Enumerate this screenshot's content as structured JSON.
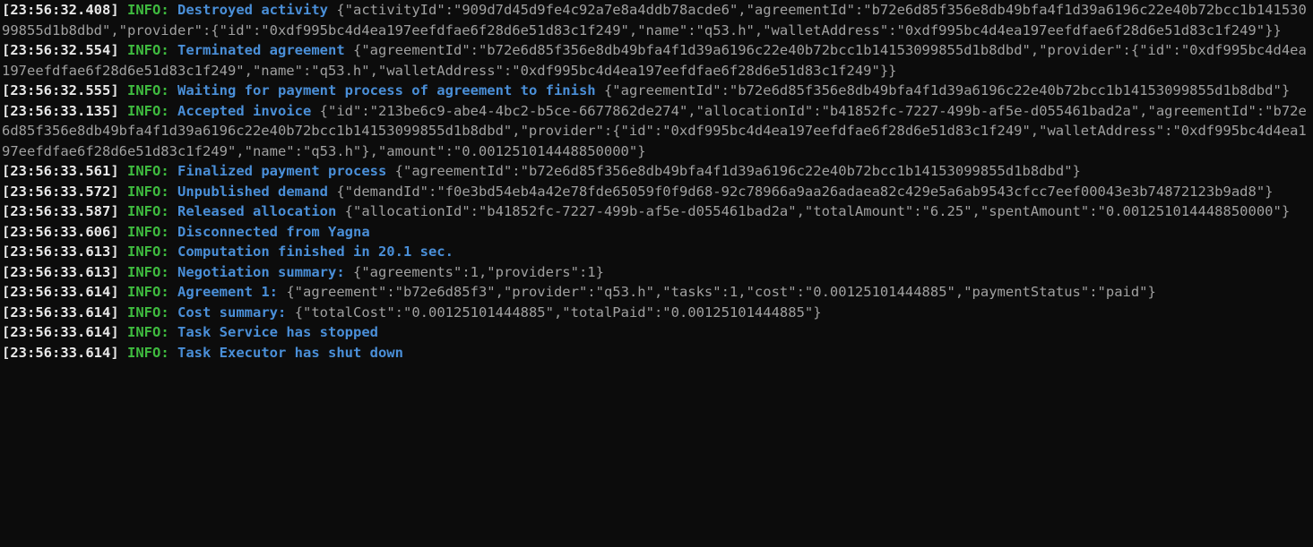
{
  "colors": {
    "bg": "#0c0c0c",
    "text": "#d0d0d0",
    "timestamp": "#e8e8e8",
    "level": "#3fbb3f",
    "message": "#4a8fd8",
    "payload": "#a0a0a0"
  },
  "log_lines": [
    {
      "timestamp": "[23:56:32.408]",
      "level": "INFO:",
      "message": "Destroyed activity",
      "payload": "{\"activityId\":\"909d7d45d9fe4c92a7e8a4ddb78acde6\",\"agreementId\":\"b72e6d85f356e8db49bfa4f1d39a6196c22e40b72bcc1b14153099855d1b8dbd\",\"provider\":{\"id\":\"0xdf995bc4d4ea197eefdfae6f28d6e51d83c1f249\",\"name\":\"q53.h\",\"walletAddress\":\"0xdf995bc4d4ea197eefdfae6f28d6e51d83c1f249\"}}"
    },
    {
      "timestamp": "[23:56:32.554]",
      "level": "INFO:",
      "message": "Terminated agreement",
      "payload": "{\"agreementId\":\"b72e6d85f356e8db49bfa4f1d39a6196c22e40b72bcc1b14153099855d1b8dbd\",\"provider\":{\"id\":\"0xdf995bc4d4ea197eefdfae6f28d6e51d83c1f249\",\"name\":\"q53.h\",\"walletAddress\":\"0xdf995bc4d4ea197eefdfae6f28d6e51d83c1f249\"}}"
    },
    {
      "timestamp": "[23:56:32.555]",
      "level": "INFO:",
      "message": "Waiting for payment process of agreement to finish",
      "payload": "{\"agreementId\":\"b72e6d85f356e8db49bfa4f1d39a6196c22e40b72bcc1b14153099855d1b8dbd\"}"
    },
    {
      "timestamp": "[23:56:33.135]",
      "level": "INFO:",
      "message": "Accepted invoice",
      "payload": "{\"id\":\"213be6c9-abe4-4bc2-b5ce-6677862de274\",\"allocationId\":\"b41852fc-7227-499b-af5e-d055461bad2a\",\"agreementId\":\"b72e6d85f356e8db49bfa4f1d39a6196c22e40b72bcc1b14153099855d1b8dbd\",\"provider\":{\"id\":\"0xdf995bc4d4ea197eefdfae6f28d6e51d83c1f249\",\"walletAddress\":\"0xdf995bc4d4ea197eefdfae6f28d6e51d83c1f249\",\"name\":\"q53.h\"},\"amount\":\"0.001251014448850000\"}"
    },
    {
      "timestamp": "[23:56:33.561]",
      "level": "INFO:",
      "message": "Finalized payment process",
      "payload": "{\"agreementId\":\"b72e6d85f356e8db49bfa4f1d39a6196c22e40b72bcc1b14153099855d1b8dbd\"}"
    },
    {
      "timestamp": "[23:56:33.572]",
      "level": "INFO:",
      "message": "Unpublished demand",
      "payload": "{\"demandId\":\"f0e3bd54eb4a42e78fde65059f0f9d68-92c78966a9aa26adaea82c429e5a6ab9543cfcc7eef00043e3b74872123b9ad8\"}"
    },
    {
      "timestamp": "[23:56:33.587]",
      "level": "INFO:",
      "message": "Released allocation",
      "payload": "{\"allocationId\":\"b41852fc-7227-499b-af5e-d055461bad2a\",\"totalAmount\":\"6.25\",\"spentAmount\":\"0.001251014448850000\"}"
    },
    {
      "timestamp": "[23:56:33.606]",
      "level": "INFO:",
      "message": "Disconnected from Yagna",
      "payload": ""
    },
    {
      "timestamp": "[23:56:33.613]",
      "level": "INFO:",
      "message": "Computation finished in 20.1 sec.",
      "payload": ""
    },
    {
      "timestamp": "[23:56:33.613]",
      "level": "INFO:",
      "message": "Negotiation summary:",
      "payload": "{\"agreements\":1,\"providers\":1}"
    },
    {
      "timestamp": "[23:56:33.614]",
      "level": "INFO:",
      "message": "Agreement 1:",
      "payload": "{\"agreement\":\"b72e6d85f3\",\"provider\":\"q53.h\",\"tasks\":1,\"cost\":\"0.00125101444885\",\"paymentStatus\":\"paid\"}"
    },
    {
      "timestamp": "[23:56:33.614]",
      "level": "INFO:",
      "message": "Cost summary:",
      "payload": "{\"totalCost\":\"0.00125101444885\",\"totalPaid\":\"0.00125101444885\"}"
    },
    {
      "timestamp": "[23:56:33.614]",
      "level": "INFO:",
      "message": "Task Service has stopped",
      "payload": ""
    },
    {
      "timestamp": "[23:56:33.614]",
      "level": "INFO:",
      "message": "Task Executor has shut down",
      "payload": ""
    }
  ]
}
